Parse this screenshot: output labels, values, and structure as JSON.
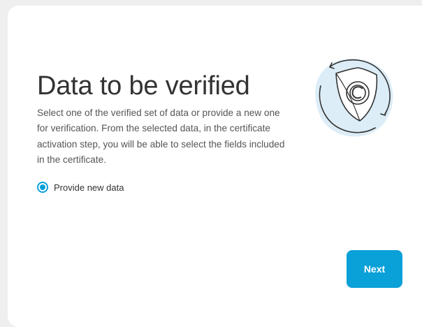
{
  "heading": "Data to be verified",
  "description": "Select one of the verified set of data or provide a new one for verification. From the selected data, in the certificate activation step, you will be able to select the fields included in the certificate.",
  "options": [
    {
      "label": "Provide new data",
      "selected": true
    }
  ],
  "next_label": "Next",
  "illustration": {
    "icon": "certificate-shield-icon"
  },
  "colors": {
    "accent": "#0aa0d8",
    "illustration_bg": "#dcedf7",
    "text": "#333333",
    "page_bg": "#efefef"
  }
}
